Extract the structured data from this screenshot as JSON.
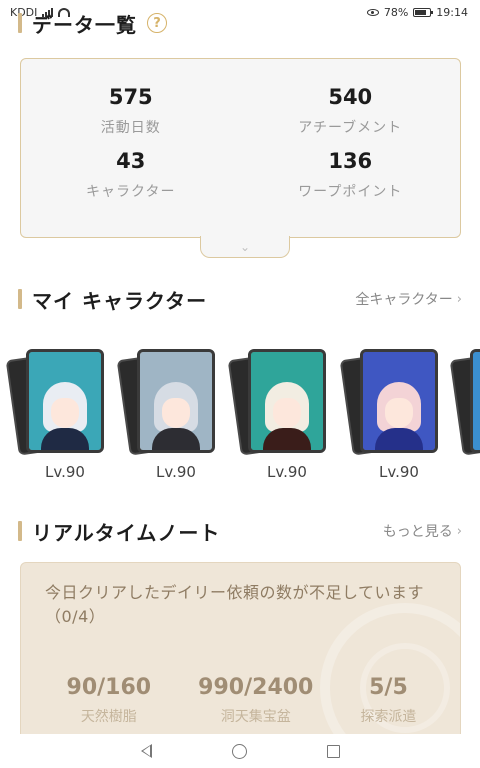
{
  "status_bar": {
    "carrier": "KDDI",
    "battery": "78%",
    "time": "19:14",
    "icons": [
      "signal-icon",
      "wifi-icon",
      "eye-icon",
      "battery-icon"
    ]
  },
  "data_overview": {
    "title": "データ一覧",
    "help_icon": "?",
    "stats": [
      {
        "value": "575",
        "label": "活動日数"
      },
      {
        "value": "540",
        "label": "アチーブメント"
      },
      {
        "value": "43",
        "label": "キャラクター"
      },
      {
        "value": "136",
        "label": "ワープポイント"
      }
    ],
    "expand_icon": "⌄"
  },
  "my_characters": {
    "title": "マイ キャラクター",
    "link": "全キャラクター",
    "chevron": "›",
    "characters": [
      {
        "level": "Lv.90",
        "bg": "#3ba7b7",
        "hair": "#e9edf3",
        "outfit": "#1f2a44"
      },
      {
        "level": "Lv.90",
        "bg": "#9fb5c5",
        "hair": "#d6dce4",
        "outfit": "#2d2d33"
      },
      {
        "level": "Lv.90",
        "bg": "#2fa59a",
        "hair": "#f2ede2",
        "outfit": "#3a1d1a"
      },
      {
        "level": "Lv.90",
        "bg": "#3f57c2",
        "hair": "#f3d3d6",
        "outfit": "#25308a"
      },
      {
        "level": "",
        "bg": "#3b8fd0",
        "hair": "#2a3a6a",
        "outfit": "#1d2b55"
      }
    ]
  },
  "realtime_note": {
    "title": "リアルタイムノート",
    "link": "もっと見る",
    "chevron": "›",
    "message": "今日クリアしたデイリー依頼の数が不足しています（0/4）",
    "stats": [
      {
        "value": "90/160",
        "label": "天然樹脂"
      },
      {
        "value": "990/2400",
        "label": "洞天集宝盆"
      },
      {
        "value": "5/5",
        "label": "探索派遣"
      }
    ]
  },
  "nav": {
    "icons": [
      "back-icon",
      "home-icon",
      "recents-icon"
    ]
  },
  "colors": {
    "accent_bar": "#d3b98a",
    "help_icon": "#d6b36a",
    "note_bg": "#efe6d8",
    "note_text": "#8f7c63"
  }
}
